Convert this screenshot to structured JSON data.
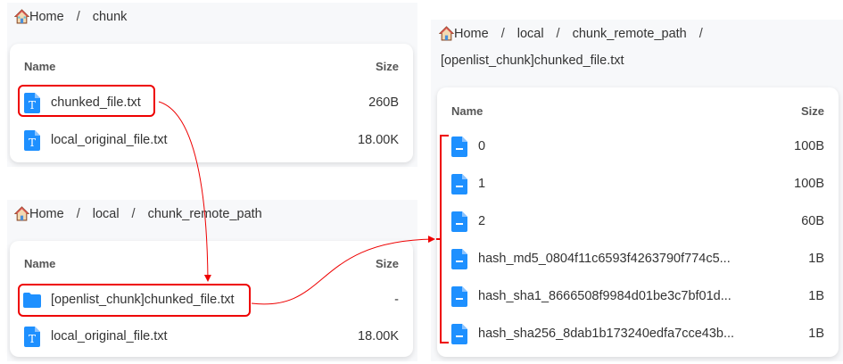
{
  "colors": {
    "icon": "#1e90ff",
    "annotation": "#e00000",
    "panel_bg": "#f7f8fa"
  },
  "panel_a": {
    "breadcrumb": [
      "Home",
      "chunk"
    ],
    "header": {
      "name": "Name",
      "size": "Size"
    },
    "rows": [
      {
        "name": "chunked_file.txt",
        "size": "260B",
        "icon": "text-file-icon"
      },
      {
        "name": "local_original_file.txt",
        "size": "18.00K",
        "icon": "text-file-icon"
      }
    ]
  },
  "panel_b": {
    "breadcrumb": [
      "Home",
      "local",
      "chunk_remote_path"
    ],
    "header": {
      "name": "Name",
      "size": "Size"
    },
    "rows": [
      {
        "name": "[openlist_chunk]chunked_file.txt",
        "size": "-",
        "icon": "folder-icon"
      },
      {
        "name": "local_original_file.txt",
        "size": "18.00K",
        "icon": "text-file-icon"
      }
    ]
  },
  "panel_c": {
    "breadcrumb": [
      "Home",
      "local",
      "chunk_remote_path",
      "[openlist_chunk]chunked_file.txt"
    ],
    "header": {
      "name": "Name",
      "size": "Size"
    },
    "rows": [
      {
        "name": "0",
        "size": "100B"
      },
      {
        "name": "1",
        "size": "100B"
      },
      {
        "name": "2",
        "size": "60B"
      },
      {
        "name": "hash_md5_0804f11c6593f4263790f774c5...",
        "size": "1B"
      },
      {
        "name": "hash_sha1_8666508f9984d01be3c7bf01d...",
        "size": "1B"
      },
      {
        "name": "hash_sha256_8dab1b173240edfa7cce43b...",
        "size": "1B"
      }
    ]
  }
}
